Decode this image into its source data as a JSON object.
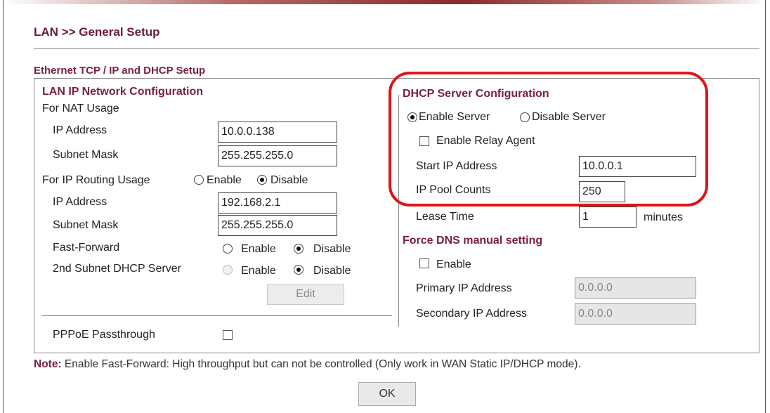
{
  "page_title": "LAN >> General Setup",
  "section_title": "Ethernet TCP / IP and DHCP Setup",
  "lan": {
    "heading": "LAN IP Network Configuration",
    "nat_usage": "For NAT Usage",
    "ip_label": "IP Address",
    "ip_value": "10.0.0.138",
    "mask_label": "Subnet Mask",
    "mask_value": "255.255.255.0",
    "routing_label": "For IP Routing Usage",
    "routing_enable": "Enable",
    "routing_disable": "Disable",
    "routing_selected": "Disable",
    "routing_ip_label": "IP Address",
    "routing_ip_value": "192.168.2.1",
    "routing_mask_label": "Subnet Mask",
    "routing_mask_value": "255.255.255.0",
    "fast_forward_label": "Fast-Forward",
    "fast_forward_enable": "Enable",
    "fast_forward_disable": "Disable",
    "fast_forward_selected": "Disable",
    "second_dhcp_label": "2nd Subnet DHCP Server",
    "second_dhcp_enable": "Enable",
    "second_dhcp_disable": "Disable",
    "second_dhcp_selected": "Disable",
    "edit_label": "Edit",
    "pppoe_label": "PPPoE Passthrough",
    "pppoe_checked": false
  },
  "dhcp": {
    "heading": "DHCP Server Configuration",
    "enable_server": "Enable Server",
    "disable_server": "Disable Server",
    "server_selected": "Enable Server",
    "relay_label": "Enable Relay Agent",
    "relay_checked": false,
    "start_ip_label": "Start IP Address",
    "start_ip_value": "10.0.0.1",
    "pool_label": "IP Pool Counts",
    "pool_value": "250",
    "lease_label": "Lease Time",
    "lease_value": "1",
    "lease_unit": "minutes"
  },
  "dns": {
    "heading": "Force DNS manual setting",
    "enable_label": "Enable",
    "enable_checked": false,
    "primary_label": "Primary IP Address",
    "primary_value": "0.0.0.0",
    "secondary_label": "Secondary IP Address",
    "secondary_value": "0.0.0.0"
  },
  "note": {
    "prefix": "Note:",
    "text": " Enable Fast-Forward: High throughput but can not be controlled (Only work in WAN Static IP/DHCP mode)."
  },
  "ok_label": "OK",
  "colors": {
    "heading": "#7a1f3a",
    "highlight": "#e0141a"
  }
}
